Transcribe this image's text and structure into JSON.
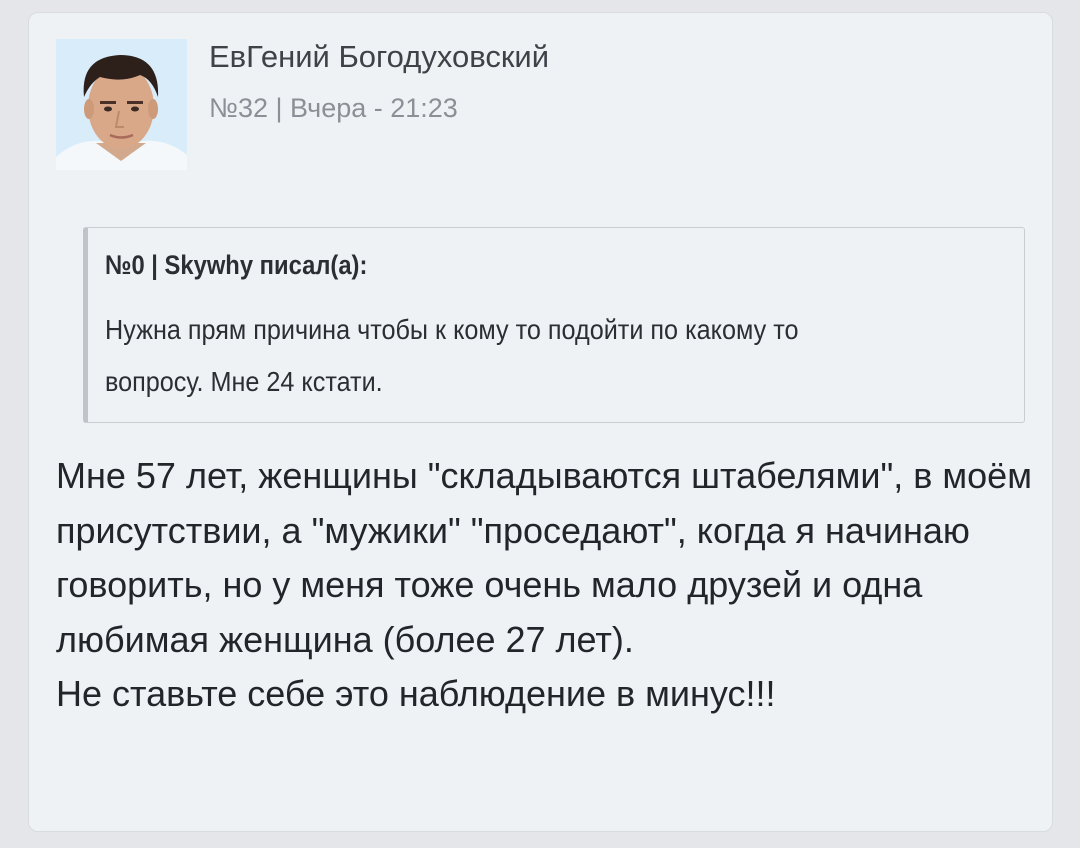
{
  "post": {
    "author_name": "ЕвГений Богодуховский",
    "meta": "№32 | Вчера - 21:23",
    "quote": {
      "header": "№0 | Skywhy писал(а):",
      "text": "Нужна прям причина чтобы к кому то подойти по какому то вопросу. Мне 24 кстати."
    },
    "body": "Мне 57 лет, женщины \"складываются штабелями\", в моём присутствии, а \"мужики\" \"проседают\", когда я начинаю говорить, но у меня тоже очень мало друзей и одна любимая женщина (более 27 лет).\nНе ставьте себе это наблюдение в минус!!!"
  }
}
